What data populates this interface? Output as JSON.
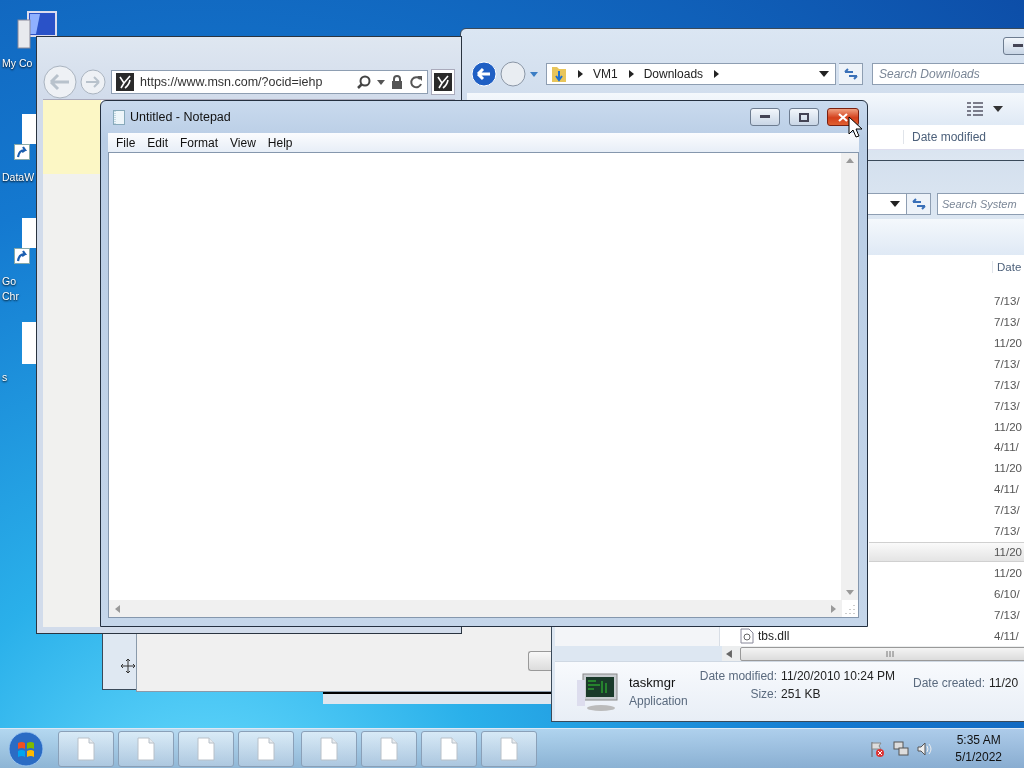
{
  "desktop_icons": [
    {
      "kind": "computer",
      "lines": [
        "My Co"
      ]
    },
    {
      "kind": "shortcut",
      "lines": [
        "DataW"
      ]
    },
    {
      "kind": "shortcut",
      "lines": [
        "Go",
        "Chr"
      ]
    },
    {
      "kind": "document",
      "lines": [
        "s"
      ]
    }
  ],
  "browser": {
    "url": "https://www.msn.com/?ocid=iehp"
  },
  "downloads_window": {
    "breadcrumb": [
      "VM1",
      "Downloads"
    ],
    "search": {
      "placeholder": "Search Downloads"
    },
    "columns": [
      "Date modified"
    ]
  },
  "system_window": {
    "search": {
      "placeholder": "Search System"
    },
    "columns": [
      "Date"
    ],
    "rows": [
      {
        "date": "7/13/",
        "selected": false
      },
      {
        "date": "7/13/",
        "selected": false
      },
      {
        "date": "11/20",
        "selected": false
      },
      {
        "date": "7/13/",
        "selected": false
      },
      {
        "date": "7/13/",
        "selected": false
      },
      {
        "date": "7/13/",
        "selected": false
      },
      {
        "date": "11/20",
        "selected": false
      },
      {
        "date": "4/11/",
        "selected": false
      },
      {
        "date": "11/20",
        "selected": false
      },
      {
        "date": "4/11/",
        "selected": false
      },
      {
        "date": "7/13/",
        "selected": false
      },
      {
        "date": "7/13/",
        "selected": false
      },
      {
        "date": "11/20",
        "selected": true
      },
      {
        "date": "11/20",
        "selected": false
      },
      {
        "date": "6/10/",
        "selected": false
      },
      {
        "date": "7/13/",
        "selected": false
      },
      {
        "name": "tbs.dll",
        "date": "4/11/",
        "selected": false
      }
    ],
    "details": {
      "name": "taskmgr",
      "type": "Application",
      "groups": [
        [
          {
            "label": "Date modified:",
            "value": "11/20/2010 10:24 PM"
          },
          {
            "label": "Size:",
            "value": "251 KB"
          }
        ],
        [
          {
            "label": "Date created:",
            "value": "11/20"
          }
        ]
      ]
    }
  },
  "notepad": {
    "title": "Untitled - Notepad",
    "menu": [
      "File",
      "Edit",
      "Format",
      "View",
      "Help"
    ],
    "close_hovered": true
  },
  "taskbar": {
    "buttons": [
      {
        "kind": "document"
      },
      {
        "kind": "document"
      },
      {
        "kind": "document"
      },
      {
        "kind": "document"
      },
      {
        "kind": "document"
      },
      {
        "kind": "document"
      },
      {
        "kind": "document"
      },
      {
        "kind": "document"
      }
    ],
    "clock": {
      "time": "5:35 AM",
      "date": "5/1/2022"
    }
  }
}
